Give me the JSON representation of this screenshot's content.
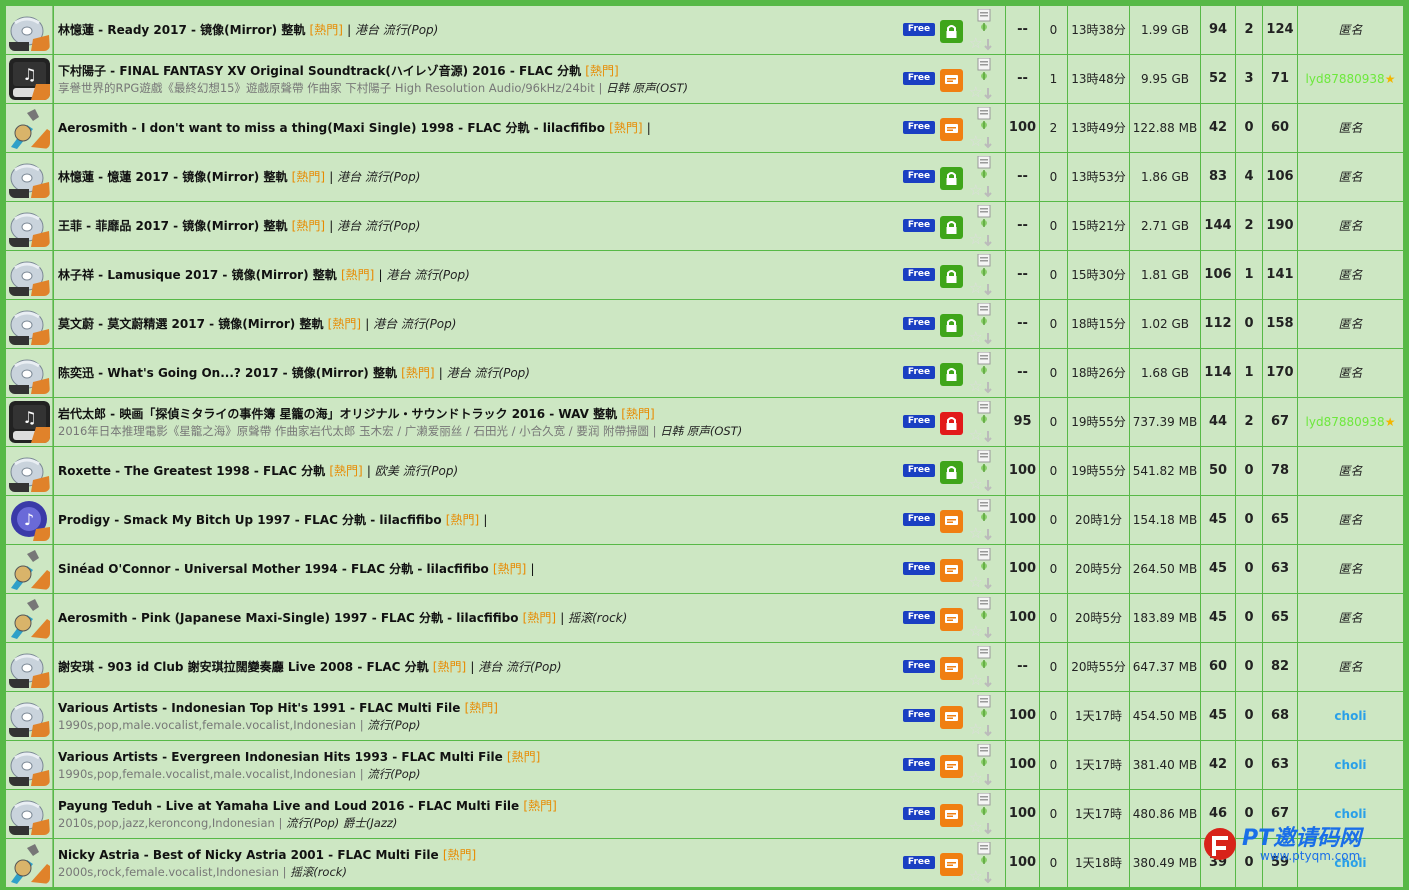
{
  "free_label": "Free",
  "colors": {
    "row_bg": "#cde7c3",
    "grid": "#57b947",
    "hot_tag": "#e88a00",
    "free_badge": "#1a3fc2",
    "lock_green": "#3fa51a",
    "lock_red": "#e21a1a",
    "comment_orange": "#f07f12",
    "uploader_green": "#6de83c",
    "uploader_blue": "#2aa0e8"
  },
  "watermark": {
    "title": "PT邀请码网",
    "url": "www.ptyqm.com"
  },
  "torrents": [
    {
      "icon": "cd",
      "title": "林憶蓮 - Ready 2017 - 镜像(Mirror) 整軌",
      "hot": "熱門",
      "tail": "",
      "category": "港台 流行(Pop)",
      "subtitle": "",
      "lock": "green",
      "progress": "--",
      "comments": "0",
      "time": "13時38分",
      "size": "1.99 GB",
      "seeders": "94",
      "leechers": "2",
      "completed": "124",
      "uploader": "匿名",
      "uploader_style": "anon",
      "star": ""
    },
    {
      "icon": "music",
      "title": "下村陽子 - FINAL FANTASY XV Original Soundtrack(ハイレゾ音源) 2016 - FLAC 分軌",
      "hot": "熱門",
      "tail": "",
      "category": "",
      "subtitle": "享譽世界的RPG遊戲《最終幻想15》遊戲原聲帶 作曲家 下村陽子 High Resolution Audio/96kHz/24bit",
      "subcat": "日韩 原声(OST)",
      "lock": "orange",
      "progress": "--",
      "comments": "1",
      "time": "13時48分",
      "size": "9.95 GB",
      "seeders": "52",
      "leechers": "3",
      "completed": "71",
      "uploader": "lyd87880938",
      "uploader_style": "green",
      "star": "★"
    },
    {
      "icon": "guitar",
      "title": "Aerosmith - I don't want to miss a thing(Maxi Single) 1998 - FLAC 分軌 - lilacfifibo",
      "hot": "熱門",
      "tail": "|",
      "category": "",
      "subtitle": "",
      "lock": "orange",
      "progress": "100",
      "comments": "2",
      "time": "13時49分",
      "size": "122.88 MB",
      "seeders": "42",
      "leechers": "0",
      "completed": "60",
      "uploader": "匿名",
      "uploader_style": "anon",
      "star": ""
    },
    {
      "icon": "cd",
      "title": "林憶蓮 - 憶蓮 2017 - 镜像(Mirror) 整軌",
      "hot": "熱門",
      "tail": "",
      "category": "港台 流行(Pop)",
      "subtitle": "",
      "lock": "green",
      "progress": "--",
      "comments": "0",
      "time": "13時53分",
      "size": "1.86 GB",
      "seeders": "83",
      "leechers": "4",
      "completed": "106",
      "uploader": "匿名",
      "uploader_style": "anon",
      "star": ""
    },
    {
      "icon": "cd",
      "title": "王菲 - 菲靡品 2017 - 镜像(Mirror) 整軌",
      "hot": "熱門",
      "tail": "",
      "category": "港台 流行(Pop)",
      "subtitle": "",
      "lock": "green",
      "progress": "--",
      "comments": "0",
      "time": "15時21分",
      "size": "2.71 GB",
      "seeders": "144",
      "leechers": "2",
      "completed": "190",
      "uploader": "匿名",
      "uploader_style": "anon",
      "star": ""
    },
    {
      "icon": "cd",
      "title": "林子祥 - Lamusique 2017 - 镜像(Mirror) 整軌",
      "hot": "熱門",
      "tail": "",
      "category": "港台 流行(Pop)",
      "subtitle": "",
      "lock": "green",
      "progress": "--",
      "comments": "0",
      "time": "15時30分",
      "size": "1.81 GB",
      "seeders": "106",
      "leechers": "1",
      "completed": "141",
      "uploader": "匿名",
      "uploader_style": "anon",
      "star": ""
    },
    {
      "icon": "cd",
      "title": "莫文蔚 - 莫文蔚精選 2017 - 镜像(Mirror) 整軌",
      "hot": "熱門",
      "tail": "",
      "category": "港台 流行(Pop)",
      "subtitle": "",
      "lock": "green",
      "progress": "--",
      "comments": "0",
      "time": "18時15分",
      "size": "1.02 GB",
      "seeders": "112",
      "leechers": "0",
      "completed": "158",
      "uploader": "匿名",
      "uploader_style": "anon",
      "star": ""
    },
    {
      "icon": "cd",
      "title": "陈奕迅 - What's Going On...? 2017 - 镜像(Mirror) 整軌",
      "hot": "熱門",
      "tail": "",
      "category": "港台 流行(Pop)",
      "subtitle": "",
      "lock": "green",
      "progress": "--",
      "comments": "0",
      "time": "18時26分",
      "size": "1.68 GB",
      "seeders": "114",
      "leechers": "1",
      "completed": "170",
      "uploader": "匿名",
      "uploader_style": "anon",
      "star": ""
    },
    {
      "icon": "music",
      "title": "岩代太郎 - 映画「探偵ミタライの事件簿 星籠の海」オリジナル・サウンドトラック 2016 - WAV 整軌",
      "hot": "熱門",
      "tail": "",
      "category": "",
      "subtitle": "2016年日本推理電影《星籠之海》原聲帶 作曲家岩代太郎 玉木宏 / 广濑爱丽丝 / 石田光 / 小合久宽 / 要润 附帶掃圖",
      "subcat": "日韩 原声(OST)",
      "lock": "red",
      "progress": "95",
      "comments": "0",
      "time": "19時55分",
      "size": "737.39 MB",
      "seeders": "44",
      "leechers": "2",
      "completed": "67",
      "uploader": "lyd87880938",
      "uploader_style": "green",
      "star": "★"
    },
    {
      "icon": "cd",
      "title": "Roxette - The Greatest 1998 - FLAC 分軌",
      "hot": "熱門",
      "tail": "",
      "category": "欧美 流行(Pop)",
      "subtitle": "",
      "lock": "green",
      "progress": "100",
      "comments": "0",
      "time": "19時55分",
      "size": "541.82 MB",
      "seeders": "50",
      "leechers": "0",
      "completed": "78",
      "uploader": "匿名",
      "uploader_style": "anon",
      "star": ""
    },
    {
      "icon": "disc",
      "title": "Prodigy - Smack My Bitch Up 1997 - FLAC 分軌 - lilacfifibo",
      "hot": "熱門",
      "tail": "|",
      "category": "",
      "subtitle": "",
      "lock": "orange",
      "progress": "100",
      "comments": "0",
      "time": "20時1分",
      "size": "154.18 MB",
      "seeders": "45",
      "leechers": "0",
      "completed": "65",
      "uploader": "匿名",
      "uploader_style": "anon",
      "star": ""
    },
    {
      "icon": "guitar",
      "title": "Sinéad O'Connor - Universal Mother 1994 - FLAC 分軌 - lilacfifibo",
      "hot": "熱門",
      "tail": "|",
      "category": "",
      "subtitle": "",
      "lock": "orange",
      "progress": "100",
      "comments": "0",
      "time": "20時5分",
      "size": "264.50 MB",
      "seeders": "45",
      "leechers": "0",
      "completed": "63",
      "uploader": "匿名",
      "uploader_style": "anon",
      "star": ""
    },
    {
      "icon": "guitar",
      "title": "Aerosmith - Pink (Japanese Maxi-Single) 1997 - FLAC 分軌 - lilacfifibo",
      "hot": "熱門",
      "tail": "",
      "category": "摇滚(rock)",
      "subtitle": "",
      "lock": "orange",
      "progress": "100",
      "comments": "0",
      "time": "20時5分",
      "size": "183.89 MB",
      "seeders": "45",
      "leechers": "0",
      "completed": "65",
      "uploader": "匿名",
      "uploader_style": "anon",
      "star": ""
    },
    {
      "icon": "cd",
      "title": "謝安琪 - 903 id Club 謝安琪拉闊變奏廳 Live 2008 - FLAC 分軌",
      "hot": "熱門",
      "tail": "",
      "category": "港台 流行(Pop)",
      "subtitle": "",
      "lock": "orange",
      "progress": "--",
      "comments": "0",
      "time": "20時55分",
      "size": "647.37 MB",
      "seeders": "60",
      "leechers": "0",
      "completed": "82",
      "uploader": "匿名",
      "uploader_style": "anon",
      "star": ""
    },
    {
      "icon": "cd",
      "title": "Various Artists - Indonesian Top Hit's 1991 - FLAC Multi File",
      "hot": "熱門",
      "tail": "",
      "category": "",
      "subtitle": "1990s,pop,male.vocalist,female.vocalist,Indonesian",
      "subcat": "流行(Pop)",
      "lock": "orange",
      "progress": "100",
      "comments": "0",
      "time": "1天17時",
      "size": "454.50 MB",
      "seeders": "45",
      "leechers": "0",
      "completed": "68",
      "uploader": "choli",
      "uploader_style": "blue",
      "star": ""
    },
    {
      "icon": "cd",
      "title": "Various Artists - Evergreen Indonesian Hits 1993 - FLAC Multi File",
      "hot": "熱門",
      "tail": "",
      "category": "",
      "subtitle": "1990s,pop,female.vocalist,male.vocalist,Indonesian",
      "subcat": "流行(Pop)",
      "lock": "orange",
      "progress": "100",
      "comments": "0",
      "time": "1天17時",
      "size": "381.40 MB",
      "seeders": "42",
      "leechers": "0",
      "completed": "63",
      "uploader": "choli",
      "uploader_style": "blue",
      "star": ""
    },
    {
      "icon": "cd",
      "title": "Payung Teduh - Live at Yamaha Live and Loud 2016 - FLAC Multi File",
      "hot": "熱門",
      "tail": "",
      "category": "",
      "subtitle": "2010s,pop,jazz,keroncong,Indonesian",
      "subcat": "流行(Pop) 爵士(Jazz)",
      "lock": "orange",
      "progress": "100",
      "comments": "0",
      "time": "1天17時",
      "size": "480.86 MB",
      "seeders": "46",
      "leechers": "0",
      "completed": "67",
      "uploader": "choli",
      "uploader_style": "blue",
      "star": ""
    },
    {
      "icon": "guitar",
      "title": "Nicky Astria - Best of Nicky Astria 2001 - FLAC Multi File",
      "hot": "熱門",
      "tail": "",
      "category": "",
      "subtitle": "2000s,rock,female.vocalist,Indonesian",
      "subcat": "摇滚(rock)",
      "lock": "orange",
      "progress": "100",
      "comments": "0",
      "time": "1天18時",
      "size": "380.49 MB",
      "seeders": "39",
      "leechers": "0",
      "completed": "59",
      "uploader": "choli",
      "uploader_style": "blue",
      "star": ""
    }
  ]
}
